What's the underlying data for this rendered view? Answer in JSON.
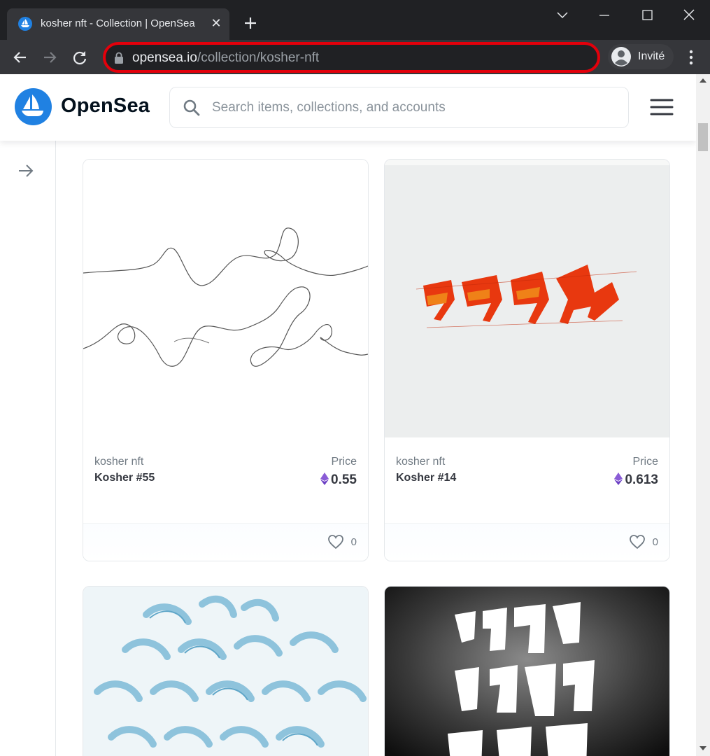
{
  "browser": {
    "tab_title": "kosher nft - Collection | OpenSea",
    "url_host": "opensea.io",
    "url_path": "/collection/kosher-nft",
    "profile_name": "Invité",
    "highlight_color": "#e3000b"
  },
  "header": {
    "brand": "OpenSea",
    "search_placeholder": "Search items, collections, and accounts",
    "brand_color": "#2081e2"
  },
  "cards": [
    {
      "collection": "kosher nft",
      "name": "Kosher #55",
      "price_label": "Price",
      "price": "0.55",
      "favorites": "0",
      "image": "line-drawing"
    },
    {
      "collection": "kosher nft",
      "name": "Kosher #14",
      "price_label": "Price",
      "price": "0.613",
      "favorites": "0",
      "image": "red-hebrew-calligraphy"
    },
    {
      "image": "blue-swirl-calligraphy"
    },
    {
      "image": "white-hebrew-on-dark"
    }
  ]
}
